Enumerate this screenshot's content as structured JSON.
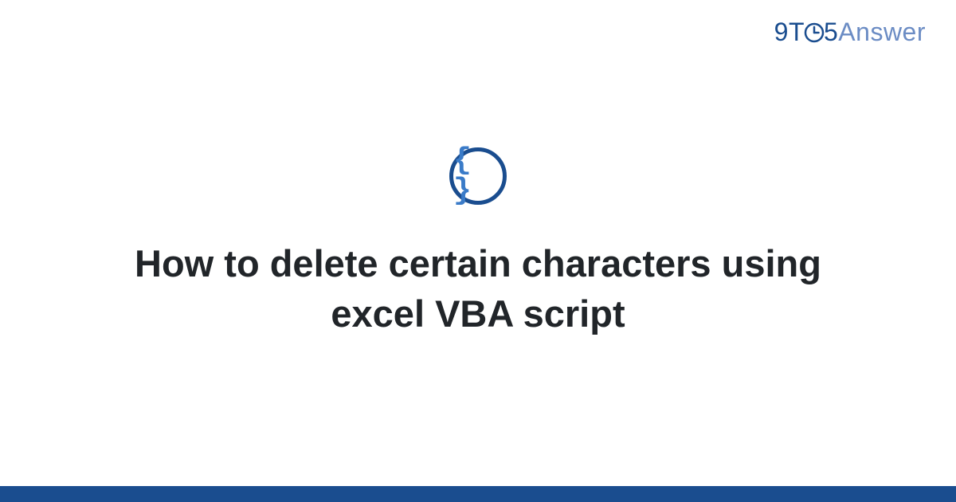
{
  "logo": {
    "part1": "9",
    "part2": "T",
    "part3": "5",
    "part4": "Answer"
  },
  "category_icon": {
    "glyph": "{ }",
    "name": "code-braces"
  },
  "title": "How to delete certain characters using excel VBA script",
  "colors": {
    "primary": "#1a4d8f",
    "secondary": "#6b8cc4",
    "accent": "#3a7bc8",
    "text": "#212529"
  }
}
